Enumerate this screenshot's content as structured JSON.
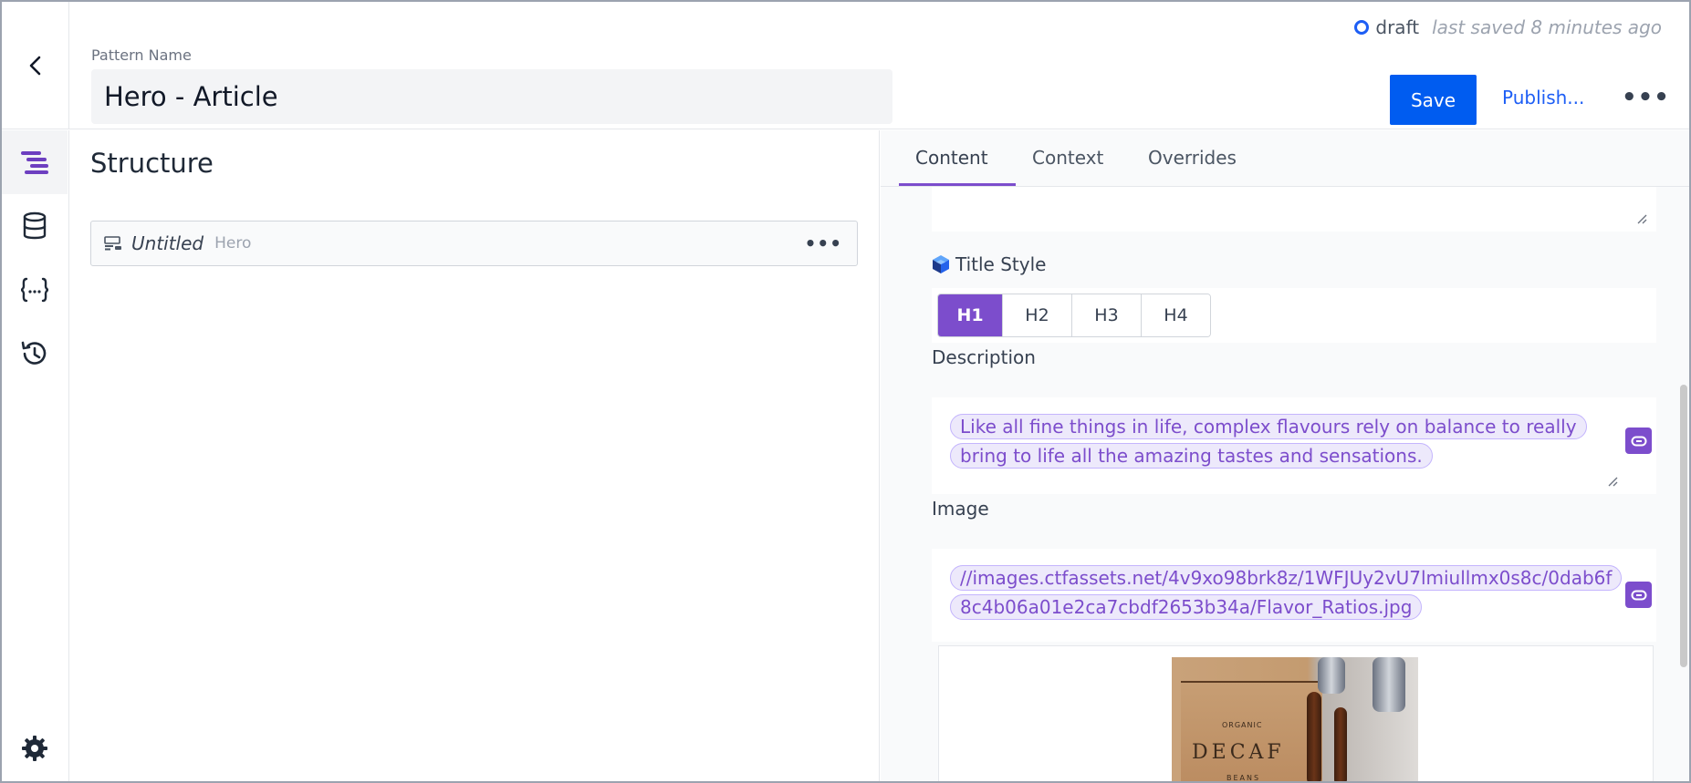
{
  "header": {
    "pattern_label": "Pattern Name",
    "pattern_name": "Hero - Article",
    "status_state": "draft",
    "status_saved": "last saved 8 minutes ago",
    "save_label": "Save",
    "publish_label": "Publish...",
    "more_label": "•••"
  },
  "rail": {
    "items": [
      "structure-icon",
      "database-icon",
      "curly-braces-icon",
      "history-icon"
    ],
    "settings": "gear-icon"
  },
  "structure": {
    "title": "Structure",
    "node": {
      "name": "Untitled",
      "type": "Hero",
      "more": "•••"
    }
  },
  "props": {
    "tabs": [
      "Content",
      "Context",
      "Overrides"
    ],
    "active_tab": "Content",
    "title_style": {
      "label": "Title Style",
      "options": [
        "H1",
        "H2",
        "H3",
        "H4"
      ],
      "selected": "H1"
    },
    "description": {
      "label": "Description",
      "value": "Like all fine things in life, complex flavours rely on balance to really bring to life all the amazing tastes and sensations."
    },
    "image": {
      "label": "Image",
      "value": "//images.ctfassets.net/4v9xo98brk8z/1WFJUy2vU7lmiullmx0s8c/0dab6f8c4b06a01e2ca7cbdf2653b34a/Flavor_Ratios.jpg",
      "preview_text": {
        "organic": "ORGANIC",
        "decaf": "DECAF",
        "beans": "BEANS"
      }
    }
  },
  "colors": {
    "accent": "#7c4dcc",
    "primary": "#005cf0",
    "status_ring": "#1d5ef5"
  }
}
